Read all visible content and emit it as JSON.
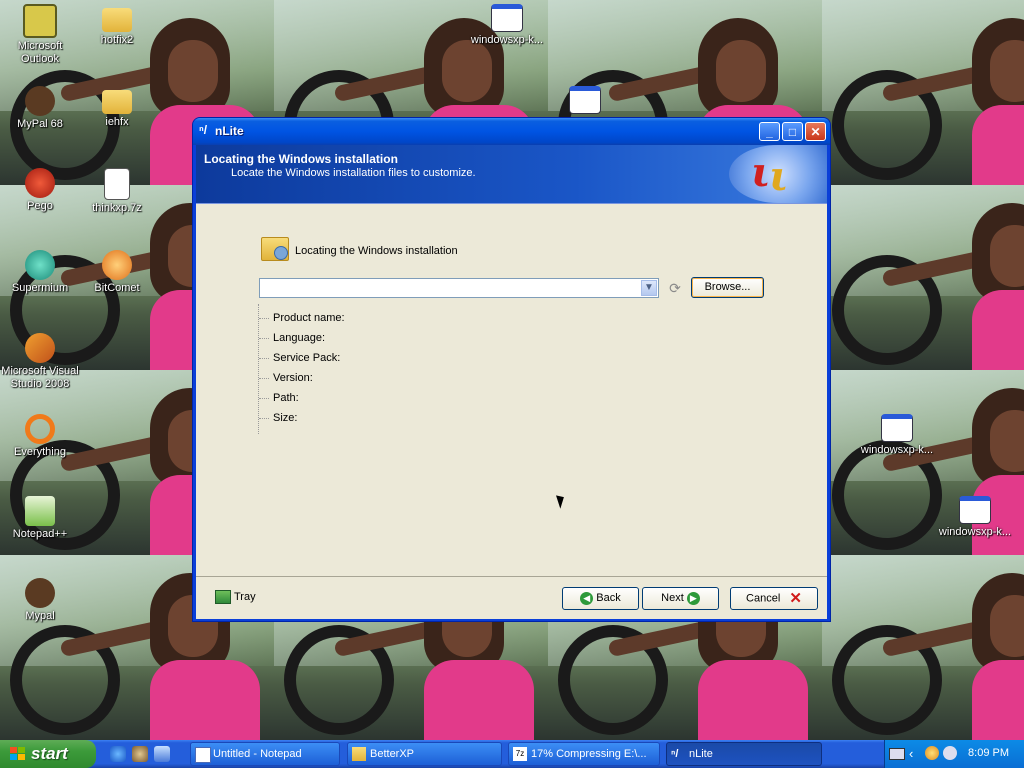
{
  "desktop": {
    "icons": [
      {
        "label": "Microsoft Outlook",
        "icon": "outlook-icon",
        "color": "#d8c84a"
      },
      {
        "label": "hotfix2",
        "icon": "folder-icon",
        "color": "#f2c94c"
      },
      {
        "label": "windowsxp-k...",
        "icon": "window-file-icon",
        "color": "#ffffff"
      },
      {
        "label": "MyPal 68",
        "icon": "mypal-icon",
        "color": "#5a3a22"
      },
      {
        "label": "iehfx",
        "icon": "folder-icon",
        "color": "#f2c94c"
      },
      {
        "label": "Pego",
        "icon": "pego-icon",
        "color": "#c8281e"
      },
      {
        "label": "thinkxp.7z",
        "icon": "archive-file-icon",
        "color": "#ffffff"
      },
      {
        "label": "Supermium",
        "icon": "supermium-icon",
        "color": "#2fb5a0"
      },
      {
        "label": "BitComet",
        "icon": "bitcomet-icon",
        "color": "#f08a1a"
      },
      {
        "label": "Microsoft Visual Studio 2008",
        "icon": "visual-studio-icon",
        "color": "#e87a1a"
      },
      {
        "label": "Everything",
        "icon": "everything-icon",
        "color": "#f07a1a"
      },
      {
        "label": "Notepad++",
        "icon": "notepadpp-icon",
        "color": "#7ac04a"
      },
      {
        "label": "Mypal",
        "icon": "mypal-icon",
        "color": "#5a3a22"
      },
      {
        "label": "windowsxp-k...",
        "icon": "window-file-icon",
        "color": "#ffffff"
      },
      {
        "label": "windowsxp-k...",
        "icon": "window-file-icon",
        "color": "#ffffff"
      }
    ]
  },
  "window": {
    "title": "nLite",
    "header": {
      "title": "Locating the Windows installation",
      "subtitle": "Locate the Windows installation files to customize."
    },
    "section_title": "Locating the Windows installation",
    "path_combo": {
      "value": ""
    },
    "browse_label": "Browse...",
    "properties": [
      {
        "label": "Product name:"
      },
      {
        "label": "Language:"
      },
      {
        "label": "Service Pack:"
      },
      {
        "label": "Version:"
      },
      {
        "label": "Path:"
      },
      {
        "label": "Size:"
      }
    ],
    "footer": {
      "tray_label": "Tray",
      "back_label": "Back",
      "next_label": "Next",
      "cancel_label": "Cancel"
    }
  },
  "taskbar": {
    "start_label": "start",
    "tasks": [
      {
        "label": "Untitled - Notepad",
        "icon": "notepad-icon"
      },
      {
        "label": "BetterXP",
        "icon": "folder-icon"
      },
      {
        "label": "17% Compressing E:\\...",
        "icon": "7zip-icon"
      },
      {
        "label": "nLite",
        "icon": "nlite-icon",
        "active": true
      }
    ],
    "clock": "8:09 PM"
  },
  "colors": {
    "title_bar": "#0054e3",
    "header_band": "#1a56c7",
    "taskbar": "#245edb",
    "start_button": "#3c9a3a",
    "close_red": "#c9371a"
  }
}
